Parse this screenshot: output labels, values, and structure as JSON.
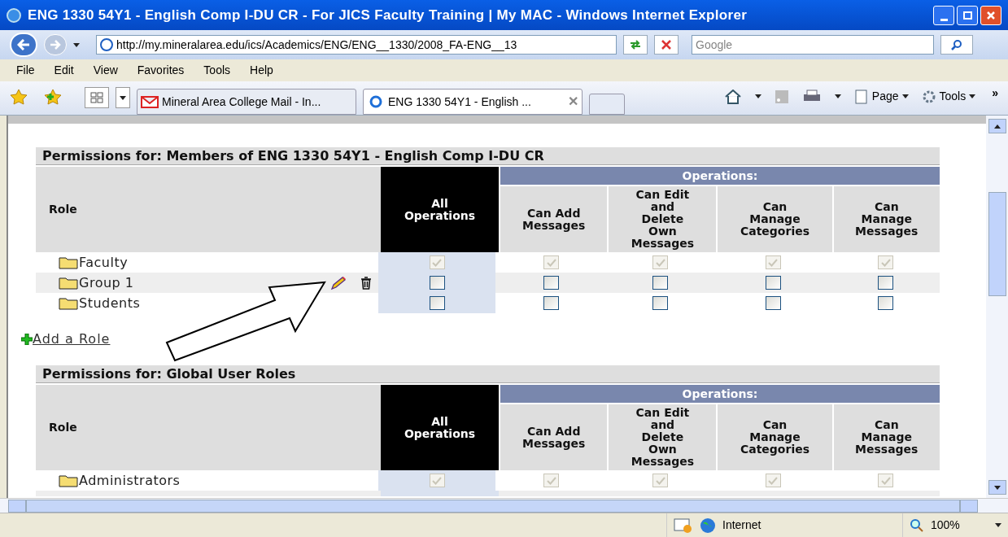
{
  "window": {
    "title": "ENG 1330 54Y1 - English Comp I-DU CR - For JICS Faculty Training | My MAC - Windows Internet Explorer"
  },
  "address_bar": {
    "value": "http://my.mineralarea.edu/ics/Academics/ENG/ENG__1330/2008_FA-ENG__13"
  },
  "search": {
    "placeholder": "Google"
  },
  "menu": [
    "File",
    "Edit",
    "View",
    "Favorites",
    "Tools",
    "Help"
  ],
  "tabs": [
    {
      "label": "Mineral Area College Mail - In...",
      "selected": false
    },
    {
      "label": "ENG 1330 54Y1 - English ...",
      "selected": true
    }
  ],
  "toolbar": {
    "page": "Page",
    "tools": "Tools",
    "more": "»",
    "close_tab": "✕"
  },
  "sections": [
    {
      "title": "Permissions for: Members of ENG 1330 54Y1 - English Comp I-DU CR",
      "role_header": "Role",
      "all_header": "All Operations",
      "operations_header": "Operations:",
      "columns": [
        "Can Add Messages",
        "Can Edit and Delete Own Messages",
        "Can Manage Categories",
        "Can Manage Messages"
      ],
      "rows": [
        {
          "name": "Faculty",
          "editable": false,
          "cells": [
            {
              "checked": true,
              "disabled": true
            },
            {
              "checked": true,
              "disabled": true
            },
            {
              "checked": true,
              "disabled": true
            },
            {
              "checked": true,
              "disabled": true
            },
            {
              "checked": true,
              "disabled": true
            }
          ]
        },
        {
          "name": "Group 1",
          "editable": true,
          "cells": [
            {
              "checked": false,
              "disabled": false
            },
            {
              "checked": false,
              "disabled": false
            },
            {
              "checked": false,
              "disabled": false
            },
            {
              "checked": false,
              "disabled": false
            },
            {
              "checked": false,
              "disabled": false
            }
          ]
        },
        {
          "name": "Students",
          "editable": false,
          "cells": [
            {
              "checked": false,
              "disabled": false
            },
            {
              "checked": false,
              "disabled": false
            },
            {
              "checked": false,
              "disabled": false
            },
            {
              "checked": false,
              "disabled": false
            },
            {
              "checked": false,
              "disabled": false
            }
          ]
        }
      ],
      "add_link": "Add a Role"
    },
    {
      "title": "Permissions for: Global User Roles",
      "role_header": "Role",
      "all_header": "All Operations",
      "operations_header": "Operations:",
      "columns": [
        "Can Add Messages",
        "Can Edit and Delete Own Messages",
        "Can Manage Categories",
        "Can Manage Messages"
      ],
      "rows": [
        {
          "name": "Administrators",
          "editable": false,
          "cells": [
            {
              "checked": true,
              "disabled": true
            },
            {
              "checked": true,
              "disabled": true
            },
            {
              "checked": true,
              "disabled": true
            },
            {
              "checked": true,
              "disabled": true
            },
            {
              "checked": true,
              "disabled": true
            }
          ]
        }
      ]
    }
  ],
  "status_bar": {
    "zone": "Internet",
    "zoom": "100%"
  }
}
